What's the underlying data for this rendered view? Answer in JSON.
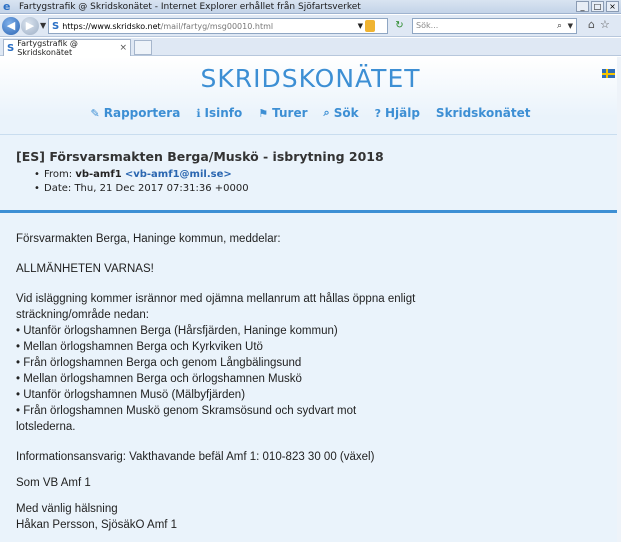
{
  "window": {
    "title": "Fartygstrafik @ Skridskonätet - Internet Explorer erhållet från Sjöfartsverket",
    "controls": [
      "_",
      "□",
      "×"
    ]
  },
  "address_bar": {
    "url_host": "https://www.skridsko.net",
    "url_path": "/mail/fartyg/msg00010.html",
    "search_placeholder": "Sök..."
  },
  "tabs": [
    {
      "label": "Fartygstrafik @ Skridskonätet",
      "close": "×"
    }
  ],
  "site": {
    "logo": "SKRIDSKONÄTET",
    "nav": [
      {
        "icon": "✎",
        "label": "Rapportera"
      },
      {
        "icon": "ℹ",
        "label": "Isinfo"
      },
      {
        "icon": "⚑",
        "label": "Turer"
      },
      {
        "icon": "⌕",
        "label": "Sök"
      },
      {
        "icon": "?",
        "label": "Hjälp"
      },
      {
        "icon": "",
        "label": "Skridskonätet"
      }
    ]
  },
  "message": {
    "title": "[ES] Försvarsmakten Berga/Muskö - isbrytning 2018",
    "from_prefix": "From:",
    "from_name": "vb-amf1",
    "from_email": "vb-amf1@mil.se",
    "date": "Date: Thu, 21 Dec 2017 07:31:36 +0000",
    "intro": "Försvarmakten Berga, Haninge kommun, meddelar:",
    "warning": "ALLMÄNHETEN VARNAS!",
    "body_lines": [
      "Vid isläggning kommer isrännor med ojämna mellanrum att hållas öppna enligt",
      "sträckning/område nedan:",
      "• Utanför örlogshamnen Berga (Hårsfjärden, Haninge kommun)",
      "• Mellan örlogshamnen Berga och Kyrkviken Utö",
      "• Från örlogshamnen Berga och genom Långbälingsund",
      "• Mellan örlogshamnen Berga och örlogshamnen Muskö",
      "• Utanför örlogshamnen Musö (Mälbyfjärden)",
      "• Från örlogshamnen Muskö genom Skramsösund och sydvart mot",
      "lotslederna."
    ],
    "info": "Informationsansvarig: Vakthavande befäl Amf 1: 010-823 30 00 (växel)",
    "sign_vb": "Som VB Amf 1",
    "closing_lines": [
      "Med vänlig hälsning",
      "Håkan Persson, SjösäkO Amf 1"
    ]
  },
  "colors": {
    "accent": "#3d8fd4",
    "page_bg": "#eaf3fb"
  }
}
